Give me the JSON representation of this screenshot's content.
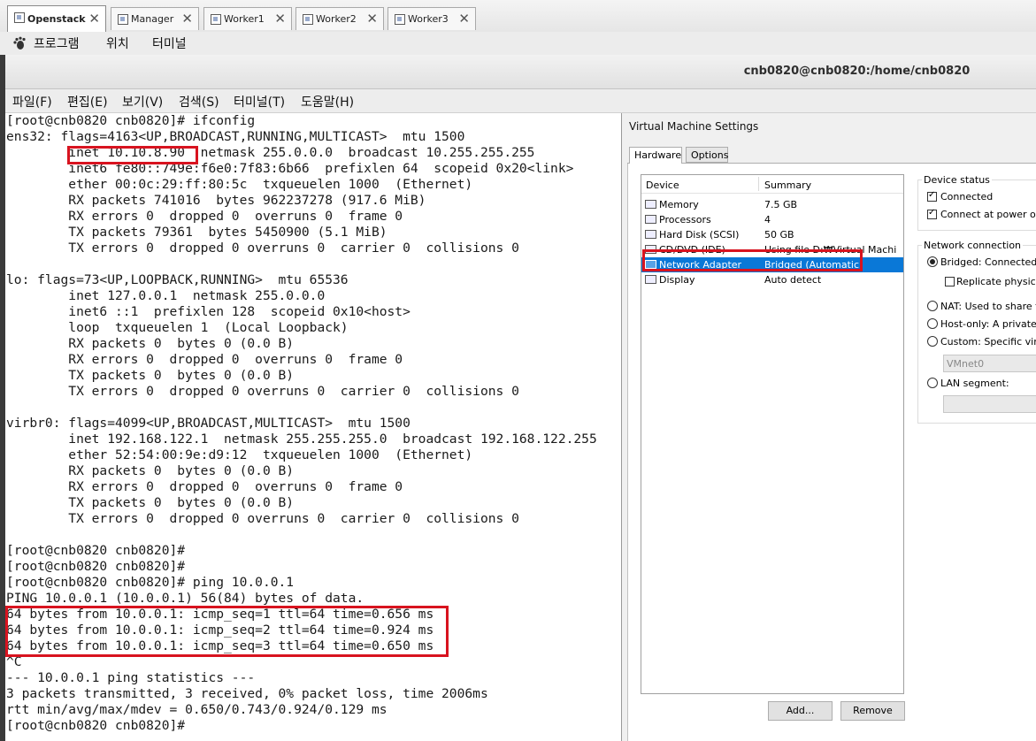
{
  "vm_tabs": [
    {
      "label": "Openstack",
      "active": true
    },
    {
      "label": "Manager",
      "active": false
    },
    {
      "label": "Worker1",
      "active": false
    },
    {
      "label": "Worker2",
      "active": false
    },
    {
      "label": "Worker3",
      "active": false
    }
  ],
  "tab_close_glyph": "✕",
  "gnome_menu": [
    "프로그램",
    "위치",
    "터미널"
  ],
  "window_title": "cnb0820@cnb0820:/home/cnb0820",
  "terminal_menu": [
    "파일(F)",
    "편집(E)",
    "보기(V)",
    "검색(S)",
    "터미널(T)",
    "도움말(H)"
  ],
  "terminal_lines": [
    "[root@cnb0820 cnb0820]# ifconfig",
    "ens32: flags=4163<UP,BROADCAST,RUNNING,MULTICAST>  mtu 1500",
    "        inet 10.10.8.90  netmask 255.0.0.0  broadcast 10.255.255.255",
    "        inet6 fe80::749e:f6e0:7f83:6b66  prefixlen 64  scopeid 0x20<link>",
    "        ether 00:0c:29:ff:80:5c  txqueuelen 1000  (Ethernet)",
    "        RX packets 741016  bytes 962237278 (917.6 MiB)",
    "        RX errors 0  dropped 0  overruns 0  frame 0",
    "        TX packets 79361  bytes 5450900 (5.1 MiB)",
    "        TX errors 0  dropped 0 overruns 0  carrier 0  collisions 0",
    "",
    "lo: flags=73<UP,LOOPBACK,RUNNING>  mtu 65536",
    "        inet 127.0.0.1  netmask 255.0.0.0",
    "        inet6 ::1  prefixlen 128  scopeid 0x10<host>",
    "        loop  txqueuelen 1  (Local Loopback)",
    "        RX packets 0  bytes 0 (0.0 B)",
    "        RX errors 0  dropped 0  overruns 0  frame 0",
    "        TX packets 0  bytes 0 (0.0 B)",
    "        TX errors 0  dropped 0 overruns 0  carrier 0  collisions 0",
    "",
    "virbr0: flags=4099<UP,BROADCAST,MULTICAST>  mtu 1500",
    "        inet 192.168.122.1  netmask 255.255.255.0  broadcast 192.168.122.255",
    "        ether 52:54:00:9e:d9:12  txqueuelen 1000  (Ethernet)",
    "        RX packets 0  bytes 0 (0.0 B)",
    "        RX errors 0  dropped 0  overruns 0  frame 0",
    "        TX packets 0  bytes 0 (0.0 B)",
    "        TX errors 0  dropped 0 overruns 0  carrier 0  collisions 0",
    "",
    "[root@cnb0820 cnb0820]#",
    "[root@cnb0820 cnb0820]#",
    "[root@cnb0820 cnb0820]# ping 10.0.0.1",
    "PING 10.0.0.1 (10.0.0.1) 56(84) bytes of data.",
    "64 bytes from 10.0.0.1: icmp_seq=1 ttl=64 time=0.656 ms",
    "64 bytes from 10.0.0.1: icmp_seq=2 ttl=64 time=0.924 ms",
    "64 bytes from 10.0.0.1: icmp_seq=3 ttl=64 time=0.650 ms",
    "^C",
    "--- 10.0.0.1 ping statistics ---",
    "3 packets transmitted, 3 received, 0% packet loss, time 2006ms",
    "rtt min/avg/max/mdev = 0.650/0.743/0.924/0.129 ms",
    "[root@cnb0820 cnb0820]#"
  ],
  "highlight_color": "#d8131f",
  "vm_settings": {
    "title": "Virtual Machine Settings",
    "tabs": [
      "Hardware",
      "Options"
    ],
    "columns": {
      "device": "Device",
      "summary": "Summary"
    },
    "devices": [
      {
        "name": "Memory",
        "summary": "7.5 GB",
        "icon": "memory-icon",
        "selected": false
      },
      {
        "name": "Processors",
        "summary": "4",
        "icon": "cpu-icon",
        "selected": false
      },
      {
        "name": "Hard Disk (SCSI)",
        "summary": "50 GB",
        "icon": "hard-disk-icon",
        "selected": false
      },
      {
        "name": "CD/DVD (IDE)",
        "summary": "Using file D:₩Virtual Machin...",
        "icon": "cd-dvd-icon",
        "selected": false
      },
      {
        "name": "Network Adapter",
        "summary": "Bridged (Automatic)",
        "icon": "network-adapter-icon",
        "selected": true
      },
      {
        "name": "Display",
        "summary": "Auto detect",
        "icon": "display-icon",
        "selected": false
      }
    ],
    "buttons": {
      "add": "Add...",
      "remove": "Remove"
    },
    "device_status": {
      "label": "Device status",
      "connected": "Connected",
      "connect_at_power_on": "Connect at power on"
    },
    "network_connection": {
      "label": "Network connection",
      "bridged": "Bridged: Connected dir",
      "replicate": "Replicate physical n",
      "nat": "NAT: Used to share the",
      "host_only": "Host-only: A private ne",
      "custom": "Custom: Specific virtua",
      "vmnet": "VMnet0",
      "lan_segment": "LAN segment:"
    },
    "selection_color": "#0a78d7"
  }
}
